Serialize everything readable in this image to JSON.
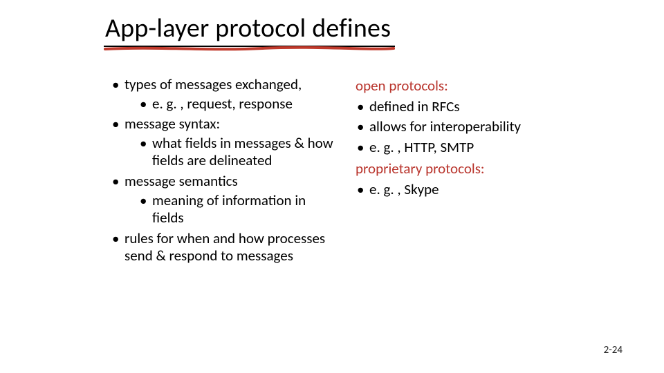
{
  "title": "App-layer protocol defines",
  "left": {
    "items": [
      {
        "text": "types of messages exchanged,",
        "sub": [
          {
            "text": "e. g. , request, response"
          }
        ]
      },
      {
        "text": "message syntax:",
        "sub": [
          {
            "text": "what fields in messages & how fields are delineated"
          }
        ]
      },
      {
        "text": "message semantics",
        "sub": [
          {
            "text": "meaning of information in fields"
          }
        ]
      },
      {
        "text": "rules for when and how processes send & respond to messages",
        "sub": []
      }
    ]
  },
  "right": {
    "open_heading": "open protocols:",
    "open_items": [
      "defined in RFCs",
      "allows for interoperability",
      "e. g. , HTTP, SMTP"
    ],
    "prop_heading": "proprietary protocols:",
    "prop_items": [
      "e. g. , Skype"
    ]
  },
  "page_number": "2-24",
  "colors": {
    "accent": "#b9352d"
  }
}
